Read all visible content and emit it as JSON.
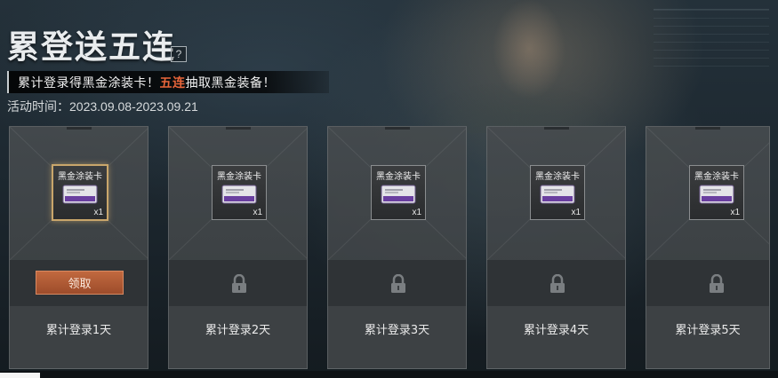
{
  "header": {
    "title": "累登送五连",
    "help_icon": "?",
    "subtitle_prefix": "累计登录得黑金涂装卡！",
    "subtitle_highlight": "五连",
    "subtitle_suffix": "抽取黑金装备！",
    "activity_time": "活动时间：2023.09.08-2023.09.21"
  },
  "colors": {
    "accent": "#e8653a",
    "claim_button": "#b05a35",
    "selected_border": "#c9a66b"
  },
  "cards": [
    {
      "reward_name": "黑金涂装卡",
      "reward_count": "x1",
      "day_label": "累计登录1天",
      "state": "claimable",
      "button_label": "领取"
    },
    {
      "reward_name": "黑金涂装卡",
      "reward_count": "x1",
      "day_label": "累计登录2天",
      "state": "locked",
      "icon": "lock-icon"
    },
    {
      "reward_name": "黑金涂装卡",
      "reward_count": "x1",
      "day_label": "累计登录3天",
      "state": "locked",
      "icon": "lock-icon"
    },
    {
      "reward_name": "黑金涂装卡",
      "reward_count": "x1",
      "day_label": "累计登录4天",
      "state": "locked",
      "icon": "lock-icon"
    },
    {
      "reward_name": "黑金涂装卡",
      "reward_count": "x1",
      "day_label": "累计登录5天",
      "state": "locked",
      "icon": "lock-icon"
    }
  ]
}
